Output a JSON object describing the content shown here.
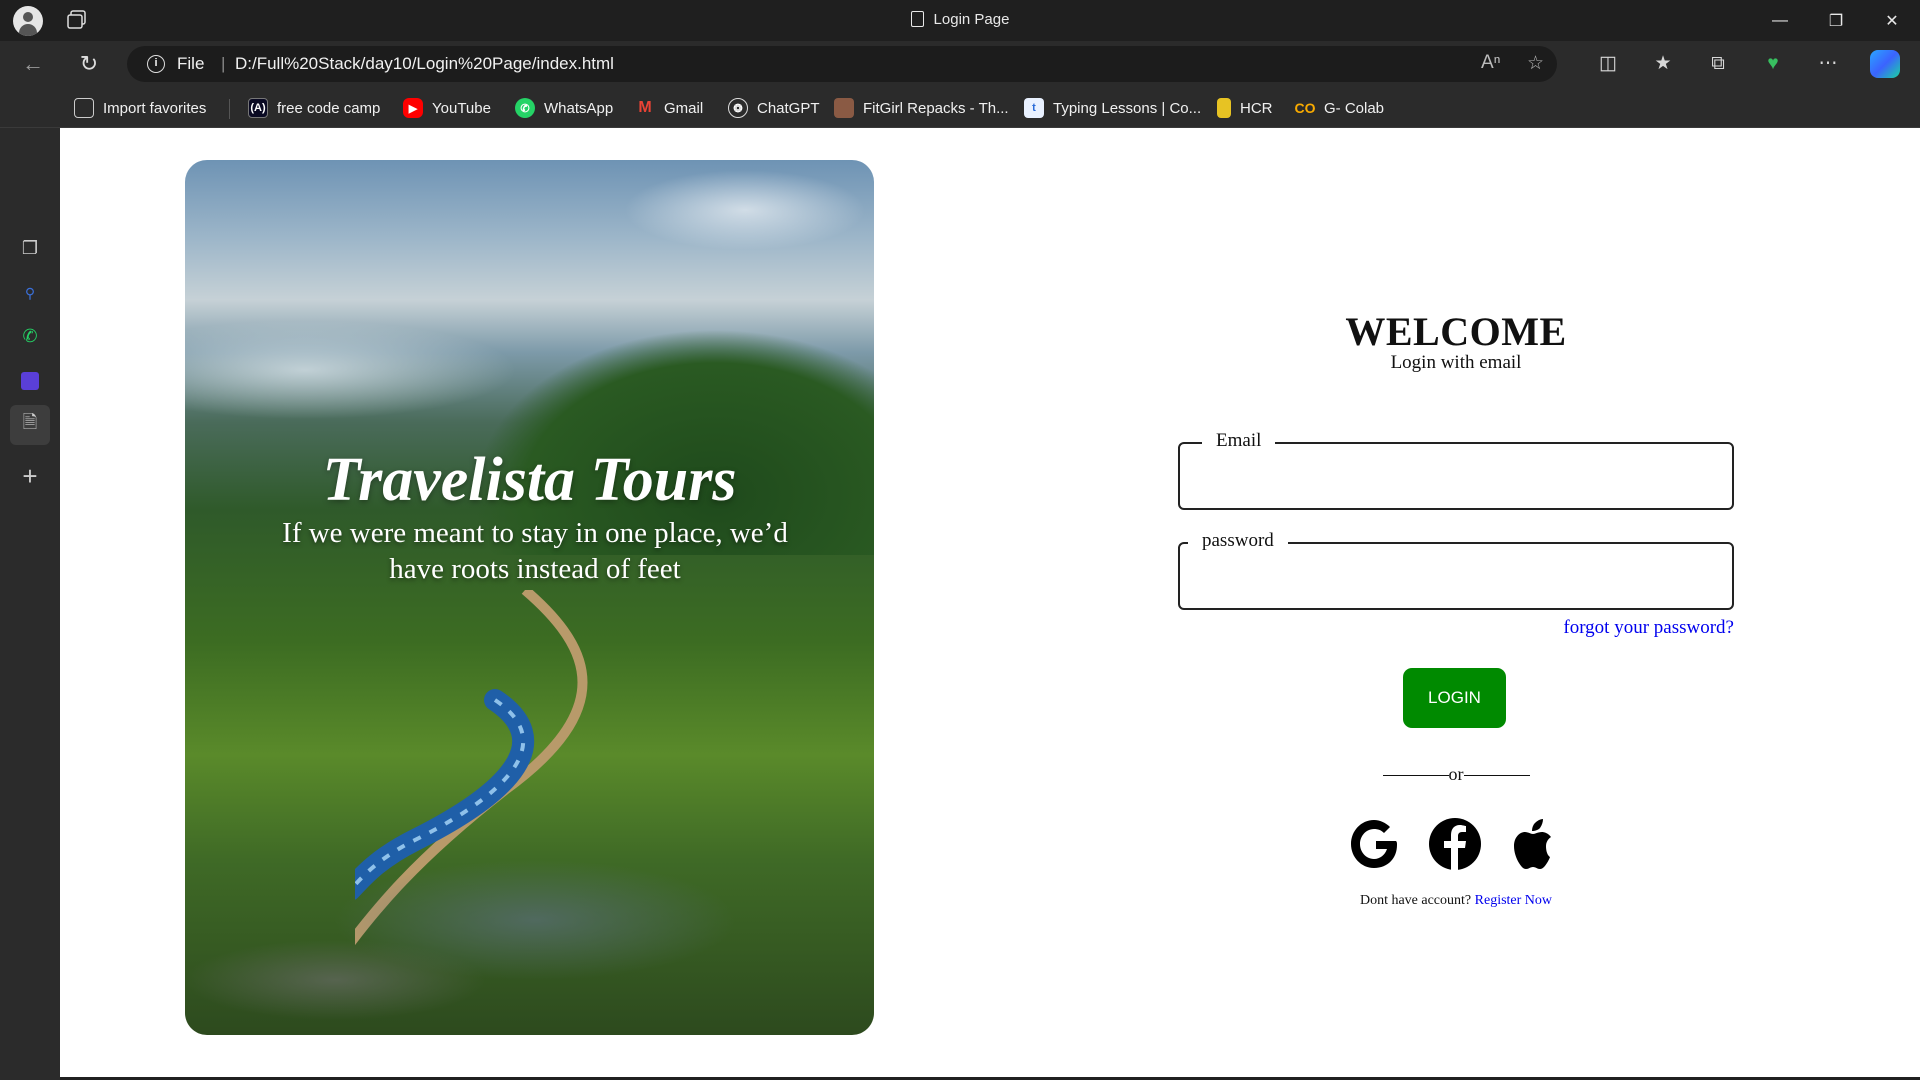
{
  "browser": {
    "window_title": "Login Page",
    "address": {
      "scheme": "File",
      "url": "D:/Full%20Stack/day10/Login%20Page/index.html"
    },
    "favorites": [
      {
        "label": "Import favorites",
        "icon": "import-favorites-icon"
      },
      {
        "label": "free code camp",
        "icon": "freecodecamp-icon"
      },
      {
        "label": "YouTube",
        "icon": "youtube-icon"
      },
      {
        "label": "WhatsApp",
        "icon": "whatsapp-icon"
      },
      {
        "label": "Gmail",
        "icon": "gmail-icon"
      },
      {
        "label": "ChatGPT",
        "icon": "chatgpt-icon"
      },
      {
        "label": "FitGirl Repacks - Th...",
        "icon": "fitgirl-icon"
      },
      {
        "label": "Typing Lessons | Co...",
        "icon": "typing-icon"
      },
      {
        "label": "HCR",
        "icon": "hcr-icon"
      },
      {
        "label": "G- Colab",
        "icon": "colab-icon"
      }
    ],
    "colors": {
      "chrome_dark": "#1f1f1f",
      "toolbar": "#2b2b2b",
      "page_bg": "#ffffff"
    }
  },
  "hero": {
    "title": "Travelista Tours",
    "tagline": "If we were meant to stay in one place, we’d have roots instead of feet"
  },
  "login": {
    "heading": "WELCOME",
    "subheading": "Login with email",
    "email_label": "Email",
    "password_label": "password",
    "forgot_link": "forgot your password?",
    "login_button": "LOGIN",
    "divider_text": "or",
    "social": [
      "google-icon",
      "facebook-icon",
      "apple-icon"
    ],
    "register_prompt": "Dont have account?",
    "register_link": "Register Now",
    "colors": {
      "button": "#008a00",
      "link": "#0000ee"
    }
  }
}
